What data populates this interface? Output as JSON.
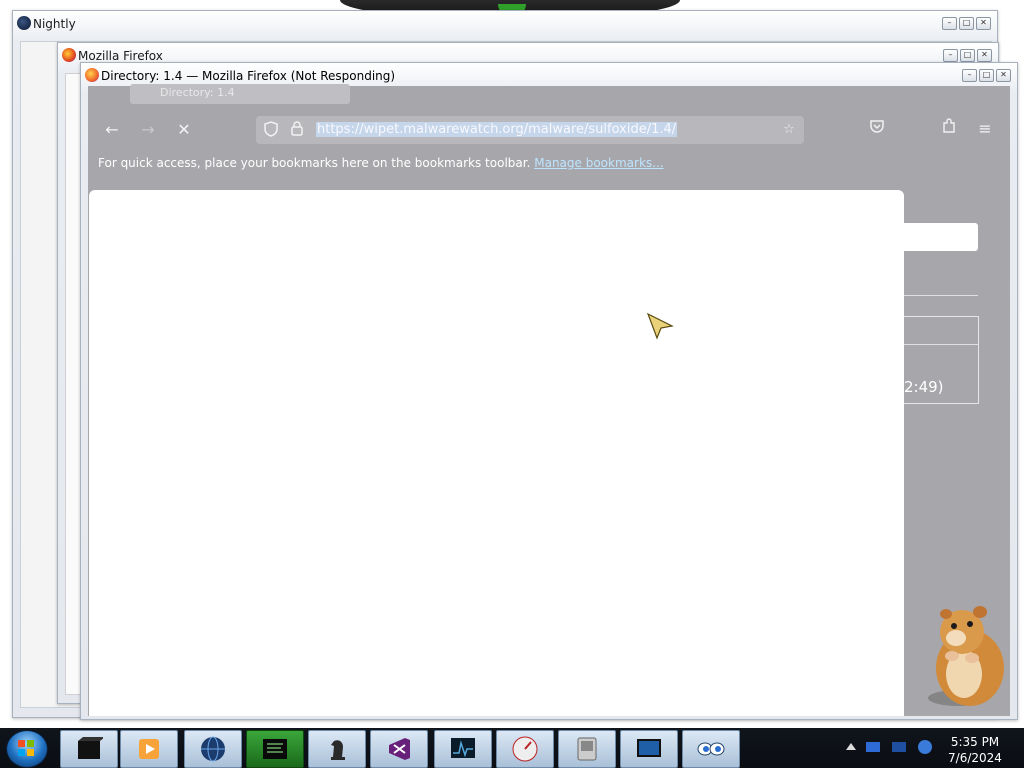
{
  "desktop": {
    "windows": {
      "nightly": {
        "title": "Nightly"
      },
      "firefox_back": {
        "title": "Mozilla Firefox"
      },
      "firefox_main": {
        "title": "Directory: 1.4 — Mozilla Firefox (Not Responding)"
      }
    }
  },
  "browser": {
    "tab_title": "Directory: 1.4",
    "url": "https://wipet.malwarewatch.org/malware/sulfoxide/1.4/",
    "bookmarks_hint": "For quick access, place your bookmarks here on the bookmarks toolbar.",
    "manage_bookmarks": "Manage bookmarks...",
    "partial_time": "2:49)"
  },
  "taskbar": {
    "clock_time": "5:35 PM",
    "clock_date": "7/6/2024",
    "apps": [
      "black-box-app",
      "media-player-app",
      "globe-app",
      "terminal-app",
      "chess-app",
      "visual-studio-app",
      "monitor-app",
      "speedometer-app",
      "device-app",
      "display-app",
      "eyes-app"
    ]
  },
  "colors": {
    "accent": "#2fa12b",
    "content_gray": "#a7a7ab",
    "taskbar": "#0a0d12"
  }
}
